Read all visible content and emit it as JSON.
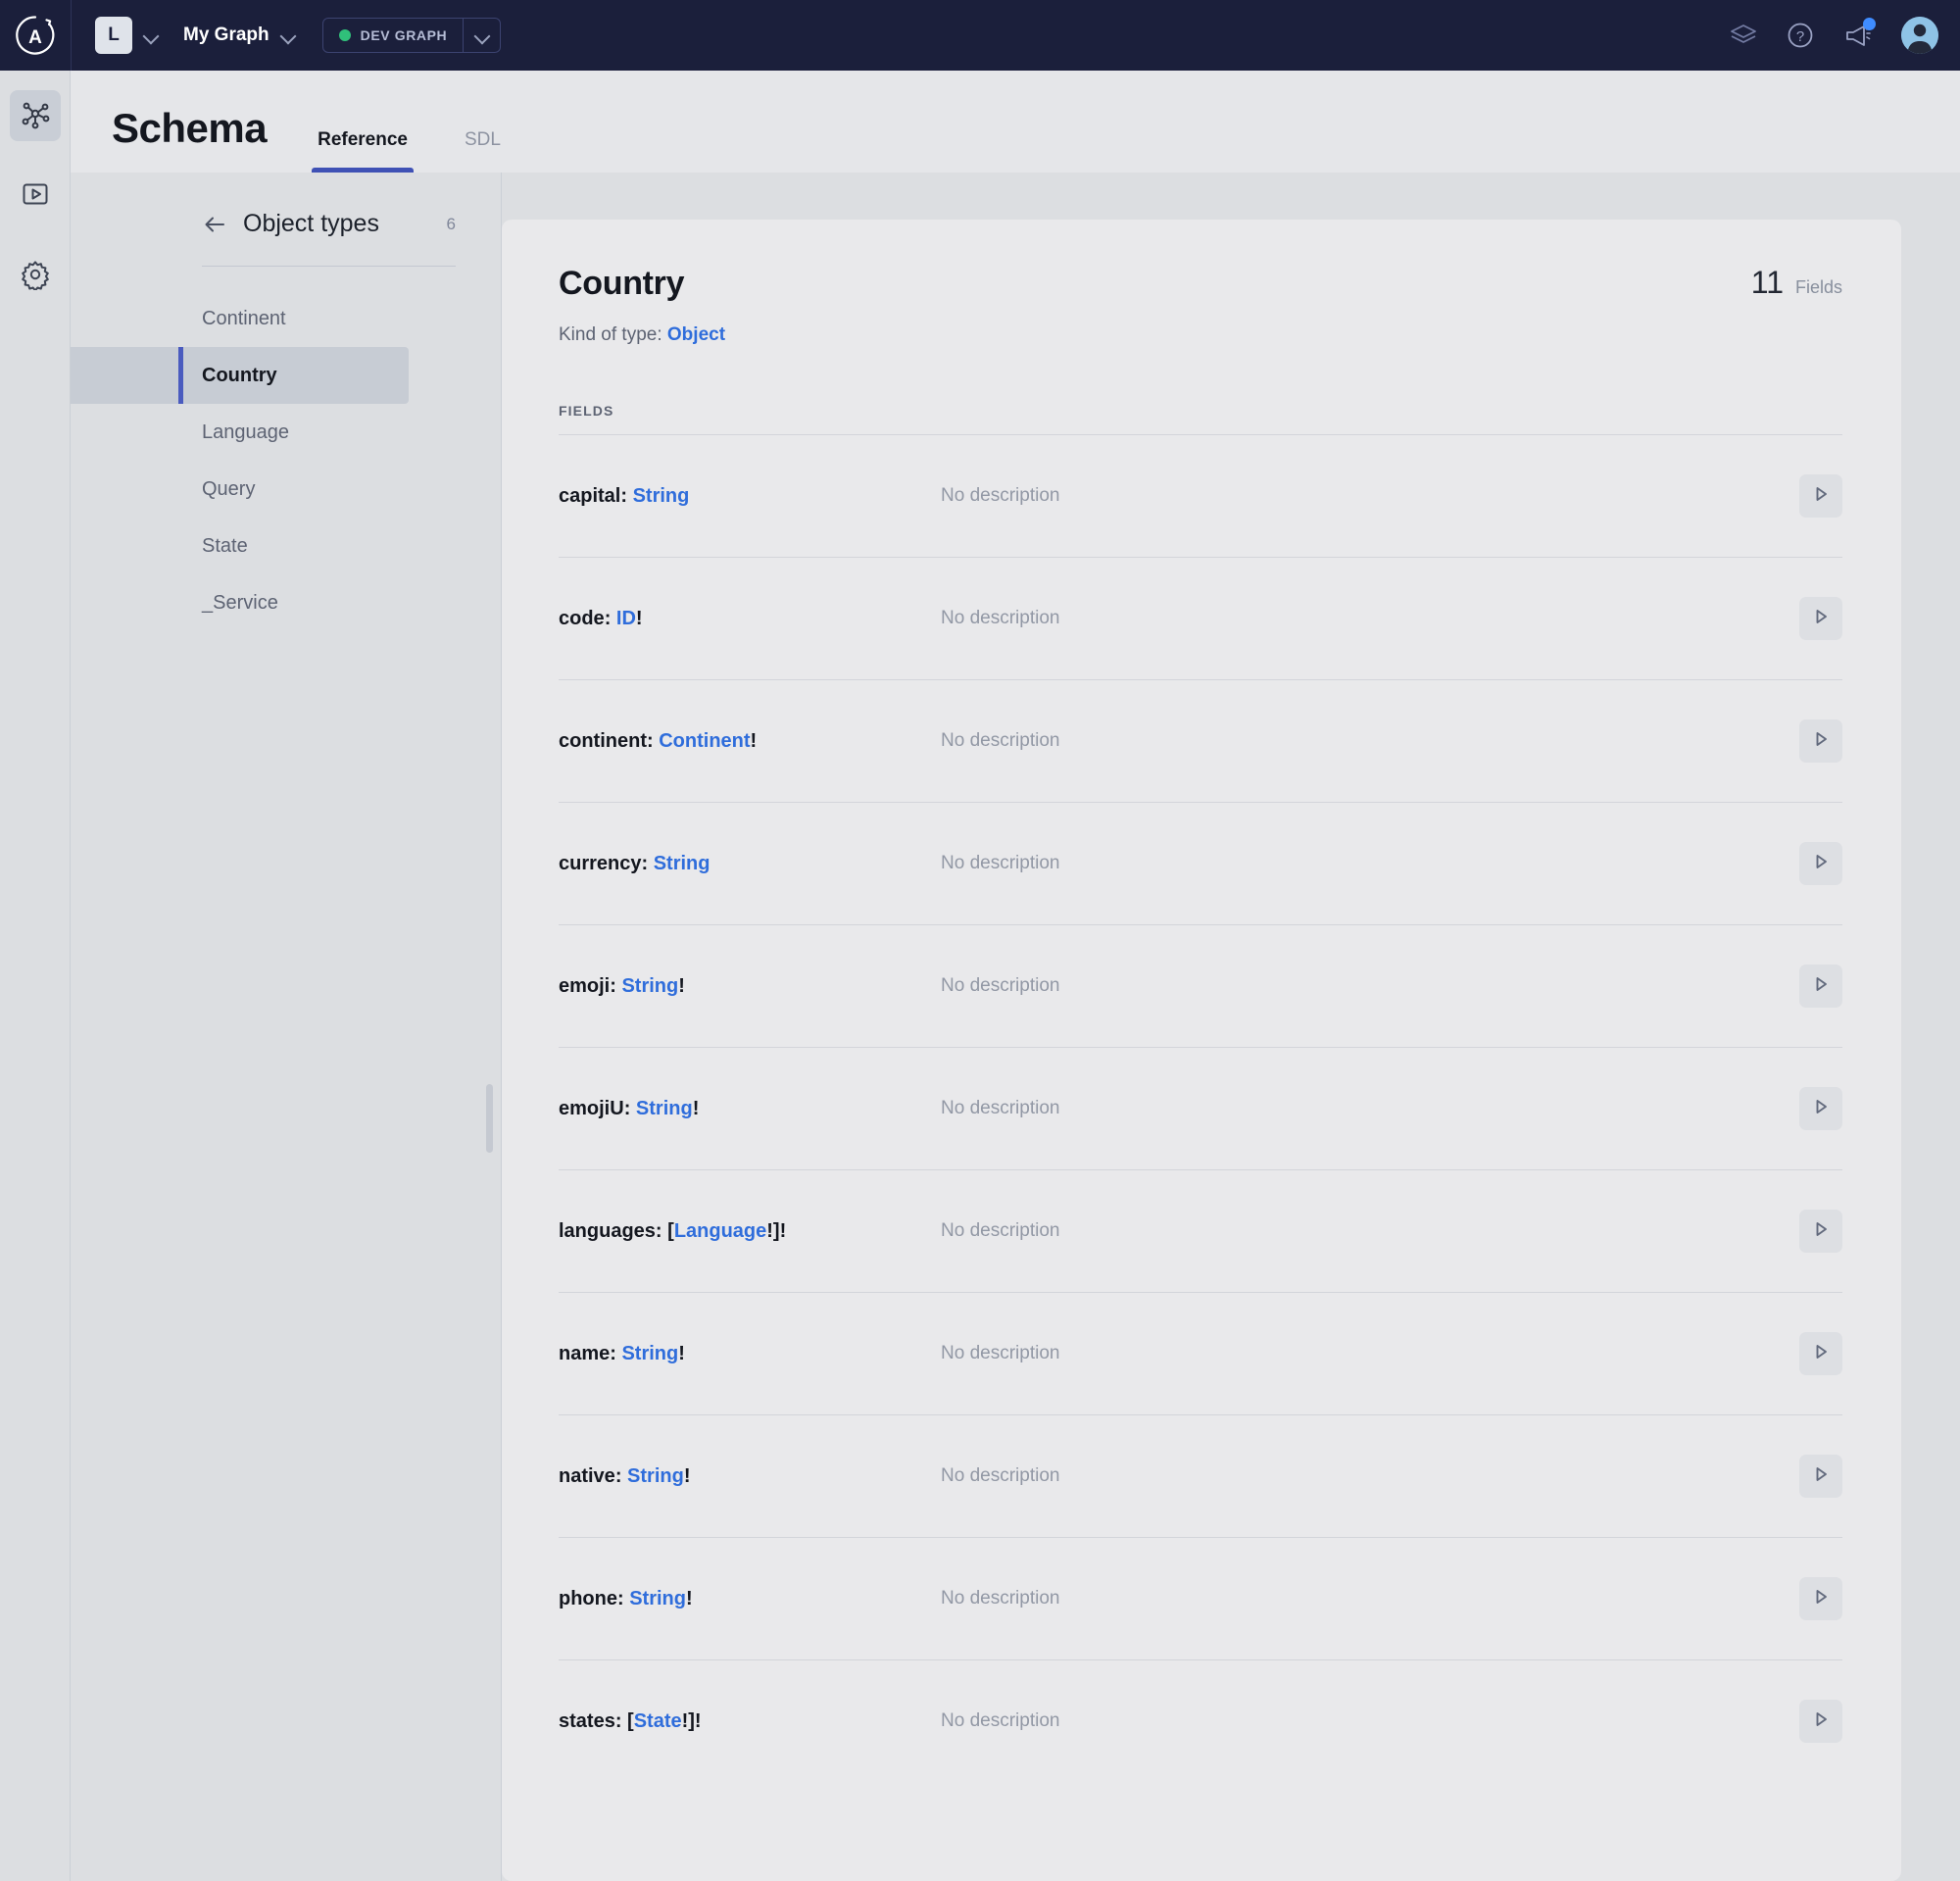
{
  "topbar": {
    "logo_icon": "apollo-logo-icon",
    "org_initial": "L",
    "org_chevron_icon": "chevron-down-icon",
    "graph_name": "My Graph",
    "graph_chevron_icon": "chevron-down-icon",
    "environment": {
      "label": "DEV GRAPH",
      "status_color": "#30c07a",
      "chevron_icon": "chevron-down-icon"
    },
    "actions": [
      {
        "icon": "layers-icon",
        "name": "layers-icon"
      },
      {
        "icon": "help-circle-icon",
        "name": "help-icon"
      },
      {
        "icon": "megaphone-icon",
        "name": "announcements-icon",
        "has_notification": true
      },
      {
        "icon": "avatar",
        "name": "user-avatar"
      }
    ]
  },
  "rail": {
    "items": [
      {
        "name": "graph-icon",
        "label": "Graph",
        "active": true
      },
      {
        "name": "explorer-play-icon",
        "label": "Explorer",
        "active": false
      },
      {
        "name": "gear-icon",
        "label": "Settings",
        "active": false
      }
    ]
  },
  "page": {
    "title": "Schema",
    "tabs": [
      {
        "label": "Reference",
        "active": true
      },
      {
        "label": "SDL",
        "active": false
      }
    ]
  },
  "typelist": {
    "back_icon": "arrow-left-icon",
    "title": "Object types",
    "count": "6",
    "items": [
      {
        "label": "Continent",
        "active": false
      },
      {
        "label": "Country",
        "active": true
      },
      {
        "label": "Language",
        "active": false
      },
      {
        "label": "Query",
        "active": false
      },
      {
        "label": "State",
        "active": false
      },
      {
        "label": "_Service",
        "active": false
      }
    ]
  },
  "detail": {
    "type_name": "Country",
    "field_count": "11",
    "field_count_label": "Fields",
    "kind_prefix": "Kind of type: ",
    "kind_value": "Object",
    "fields_section_label": "FIELDS",
    "run_icon": "play-icon",
    "no_description": "No description",
    "fields": [
      {
        "name": "capital",
        "sep": ": ",
        "type": "String",
        "suffix": "",
        "prefix": "",
        "description": "No description"
      },
      {
        "name": "code",
        "sep": ": ",
        "type": "ID",
        "suffix": "!",
        "prefix": "",
        "description": "No description"
      },
      {
        "name": "continent",
        "sep": ": ",
        "type": "Continent",
        "suffix": "!",
        "prefix": "",
        "description": "No description"
      },
      {
        "name": "currency",
        "sep": ": ",
        "type": "String",
        "suffix": "",
        "prefix": "",
        "description": "No description"
      },
      {
        "name": "emoji",
        "sep": ": ",
        "type": "String",
        "suffix": "!",
        "prefix": "",
        "description": "No description"
      },
      {
        "name": "emojiU",
        "sep": ": ",
        "type": "String",
        "suffix": "!",
        "prefix": "",
        "description": "No description"
      },
      {
        "name": "languages",
        "sep": ": ",
        "type": "Language",
        "suffix": "!]!",
        "prefix": "[",
        "description": "No description"
      },
      {
        "name": "name",
        "sep": ": ",
        "type": "String",
        "suffix": "!",
        "prefix": "",
        "description": "No description"
      },
      {
        "name": "native",
        "sep": ": ",
        "type": "String",
        "suffix": "!",
        "prefix": "",
        "description": "No description"
      },
      {
        "name": "phone",
        "sep": ": ",
        "type": "String",
        "suffix": "!",
        "prefix": "",
        "description": "No description"
      },
      {
        "name": "states",
        "sep": ": ",
        "type": "State",
        "suffix": "!]!",
        "prefix": "[",
        "description": "No description"
      }
    ]
  },
  "colors": {
    "topbar_bg": "#1b1f3b",
    "page_bg": "#dcdee1",
    "card_bg": "#e9e9eb",
    "accent_blue": "#2f6ddb",
    "tab_underline": "#3f51b5",
    "active_item_bar": "#4a5bbf",
    "status_green": "#30c07a",
    "notification_blue": "#3f8cff"
  }
}
